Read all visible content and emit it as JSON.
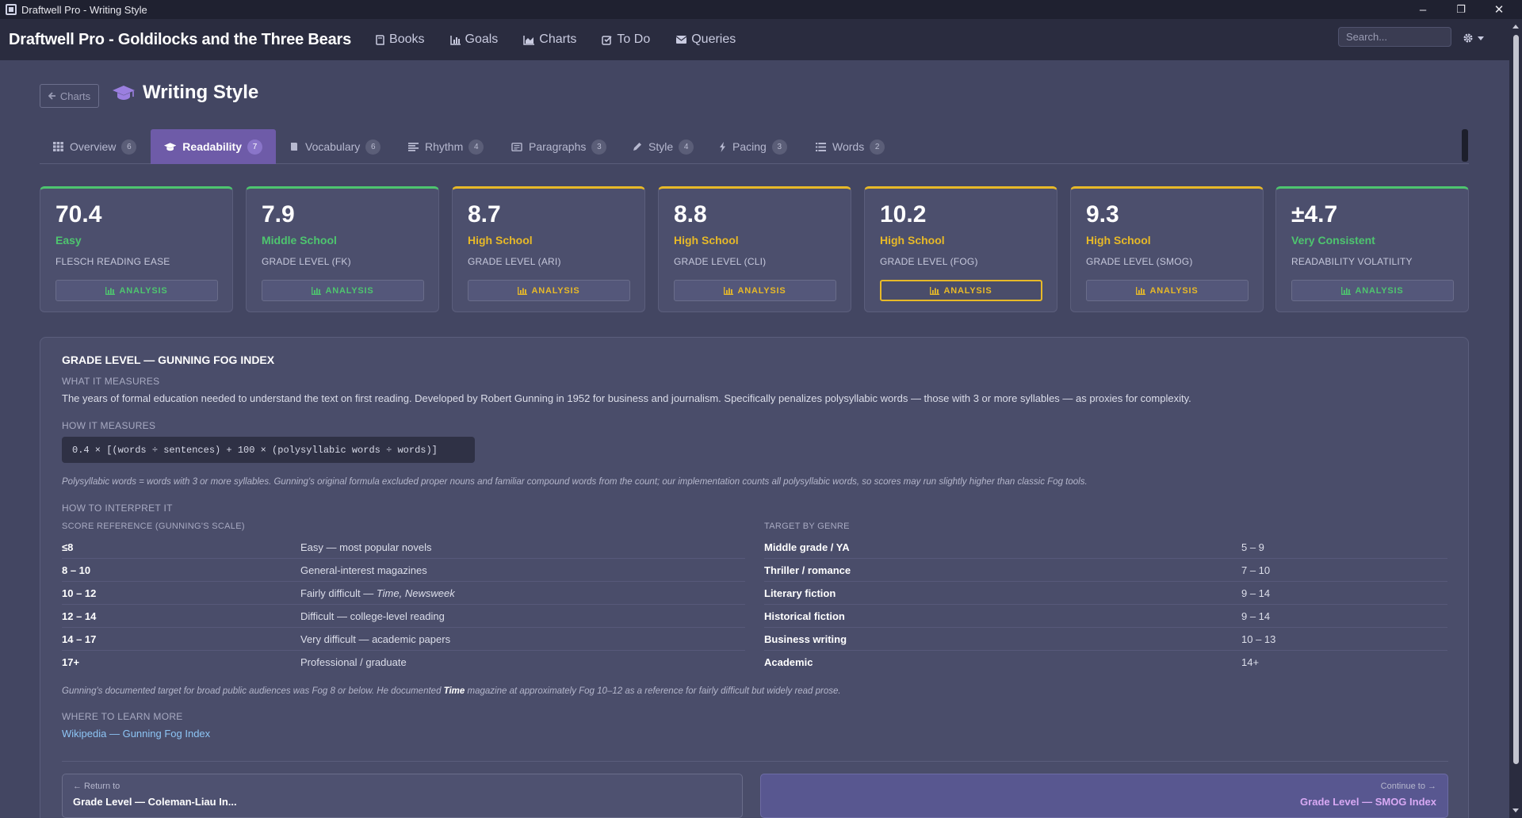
{
  "window": {
    "title": "Draftwell Pro - Writing Style",
    "controls": [
      "–",
      "❐",
      "✕"
    ]
  },
  "navbar": {
    "brand": "Draftwell Pro - Goldilocks and the Three Bears",
    "links": [
      {
        "label": "Books",
        "icon": "book-icon"
      },
      {
        "label": "Goals",
        "icon": "bar-chart-icon"
      },
      {
        "label": "Charts",
        "icon": "area-chart-icon"
      },
      {
        "label": "To Do",
        "icon": "checkbox-icon"
      },
      {
        "label": "Queries",
        "icon": "envelope-icon"
      }
    ],
    "search_placeholder": "Search...",
    "settings_icon": "gear-icon"
  },
  "header": {
    "back_label": "Charts",
    "title": "Writing Style",
    "title_icon": "graduation-cap-icon"
  },
  "tabs": [
    {
      "label": "Overview",
      "count": "6",
      "icon": "grid-icon"
    },
    {
      "label": "Readability",
      "count": "7",
      "icon": "graduation-cap-icon",
      "active": true
    },
    {
      "label": "Vocabulary",
      "count": "6",
      "icon": "book-icon"
    },
    {
      "label": "Rhythm",
      "count": "4",
      "icon": "align-left-icon"
    },
    {
      "label": "Paragraphs",
      "count": "3",
      "icon": "newspaper-icon"
    },
    {
      "label": "Style",
      "count": "4",
      "icon": "pencil-icon"
    },
    {
      "label": "Pacing",
      "count": "3",
      "icon": "bolt-icon"
    },
    {
      "label": "Words",
      "count": "2",
      "icon": "list-icon"
    }
  ],
  "metrics": [
    {
      "value": "70.4",
      "level": "Easy",
      "label": "FLESCH READING EASE",
      "button": "ANALYSIS",
      "tone": "green"
    },
    {
      "value": "7.9",
      "level": "Middle School",
      "label": "GRADE LEVEL (FK)",
      "button": "ANALYSIS",
      "tone": "green"
    },
    {
      "value": "8.7",
      "level": "High School",
      "label": "GRADE LEVEL (ARI)",
      "button": "ANALYSIS",
      "tone": "yellow"
    },
    {
      "value": "8.8",
      "level": "High School",
      "label": "GRADE LEVEL (CLI)",
      "button": "ANALYSIS",
      "tone": "yellow"
    },
    {
      "value": "10.2",
      "level": "High School",
      "label": "GRADE LEVEL (FOG)",
      "button": "ANALYSIS",
      "tone": "yellow",
      "focused": true
    },
    {
      "value": "9.3",
      "level": "High School",
      "label": "GRADE LEVEL (SMOG)",
      "button": "ANALYSIS",
      "tone": "yellow"
    },
    {
      "value": "±4.7",
      "level": "Very Consistent",
      "label": "READABILITY VOLATILITY",
      "button": "ANALYSIS",
      "tone": "green"
    }
  ],
  "colors": {
    "green": "#4ec56f",
    "yellow": "#e7b928",
    "accent": "#6e5ba8",
    "link": "#8dc5f5"
  },
  "detail": {
    "title": "GRADE LEVEL — GUNNING FOG INDEX",
    "what_heading": "WHAT IT MEASURES",
    "what_text": "The years of formal education needed to understand the text on first reading. Developed by Robert Gunning in 1952 for business and journalism. Specifically penalizes polysyllabic words — those with 3 or more syllables — as proxies for complexity.",
    "how_heading": "HOW IT MEASURES",
    "formula": "0.4 × [(words ÷ sentences) + 100 × (polysyllabic words ÷ words)]",
    "how_note": "Polysyllabic words = words with 3 or more syllables. Gunning's original formula excluded proper nouns and familiar compound words from the count; our implementation counts all polysyllabic words, so scores may run slightly higher than classic Fog tools.",
    "interpret_heading": "HOW TO INTERPRET IT",
    "scale_heading": "SCORE REFERENCE (GUNNING'S SCALE)",
    "scale": [
      {
        "score": "≤8",
        "desc": "Easy — most popular novels"
      },
      {
        "score": "8 – 10",
        "desc": "General-interest magazines"
      },
      {
        "score": "10 – 12",
        "desc": "Fairly difficult — ",
        "desc_em": "Time, Newsweek"
      },
      {
        "score": "12 – 14",
        "desc": "Difficult — college-level reading"
      },
      {
        "score": "14 – 17",
        "desc": "Very difficult — academic papers"
      },
      {
        "score": "17+",
        "desc": "Professional / graduate"
      }
    ],
    "genre_heading": "TARGET BY GENRE",
    "genres": [
      {
        "genre": "Middle grade / YA",
        "range": "5 – 9"
      },
      {
        "genre": "Thriller / romance",
        "range": "7 – 10"
      },
      {
        "genre": "Literary fiction",
        "range": "9 – 14"
      },
      {
        "genre": "Historical fiction",
        "range": "9 – 14"
      },
      {
        "genre": "Business writing",
        "range": "10 – 13"
      },
      {
        "genre": "Academic",
        "range": "14+"
      }
    ],
    "interpret_note_a": "Gunning's documented target for broad public audiences was Fog 8 or below. He documented ",
    "interpret_note_b": "Time",
    "interpret_note_c": " magazine at approximately Fog 10–12 as a reference for fairly difficult but widely read prose.",
    "learn_heading": "WHERE TO LEARN MORE",
    "learn_link": "Wikipedia — Gunning Fog Index",
    "prev": {
      "small": "← Return to",
      "title": "Grade Level — Coleman-Liau In..."
    },
    "next": {
      "small": "Continue to →",
      "title": "Grade Level — SMOG Index"
    }
  }
}
